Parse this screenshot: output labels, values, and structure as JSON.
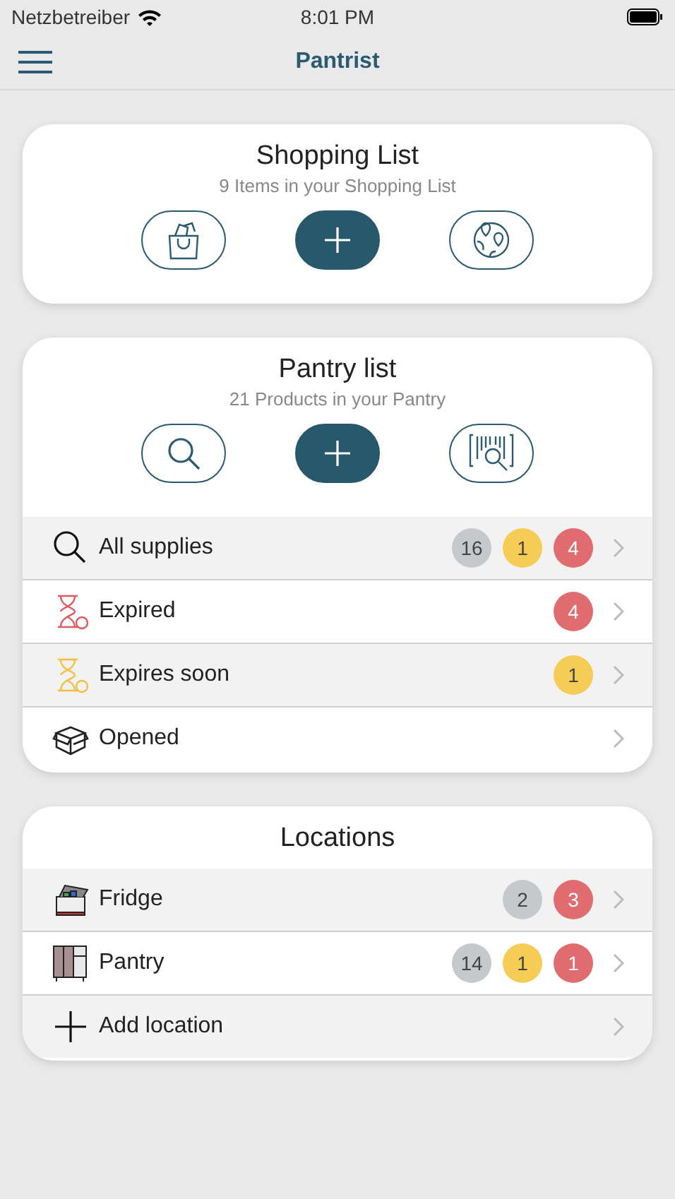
{
  "status_bar": {
    "carrier": "Netzbetreiber",
    "time": "8:01 PM"
  },
  "nav_bar": {
    "title": "Pantrist"
  },
  "shopping_card": {
    "title": "Shopping List",
    "subtitle": "9 Items in your Shopping List",
    "buttons": [
      {
        "kind": "bag"
      },
      {
        "kind": "add"
      },
      {
        "kind": "map"
      }
    ]
  },
  "pantry_card": {
    "title": "Pantry list",
    "subtitle": "21 Products in your Pantry",
    "buttons": [
      {
        "kind": "search"
      },
      {
        "kind": "add"
      },
      {
        "kind": "barcode"
      }
    ],
    "rows": [
      {
        "kind": "search",
        "label": "All supplies",
        "badges": [
          {
            "text": "16",
            "color": "#c6c9cc"
          },
          {
            "text": "1",
            "color": "#f5cc55"
          },
          {
            "text": "4",
            "color": "#e06c70"
          }
        ]
      },
      {
        "kind": "expired",
        "label": "Expired",
        "badges": [
          {
            "text": "4",
            "color": "#e06c70"
          }
        ]
      },
      {
        "kind": "soon",
        "label": "Expires soon",
        "badges": [
          {
            "text": "1",
            "color": "#f5cc55"
          }
        ]
      },
      {
        "kind": "opened",
        "label": "Opened",
        "badges": []
      }
    ]
  },
  "locations_card": {
    "title": "Locations",
    "rows": [
      {
        "kind": "fridge",
        "label": "Fridge",
        "badges": [
          {
            "text": "2",
            "color": "#c6c9cc"
          },
          {
            "text": "3",
            "color": "#e06c70"
          }
        ]
      },
      {
        "kind": "pantry",
        "label": "Pantry",
        "badges": [
          {
            "text": "14",
            "color": "#c6c9cc"
          },
          {
            "text": "1",
            "color": "#f5cc55"
          },
          {
            "text": "1",
            "color": "#e06c70"
          }
        ]
      },
      {
        "kind": "add",
        "label": "Add location",
        "badges": []
      }
    ]
  }
}
